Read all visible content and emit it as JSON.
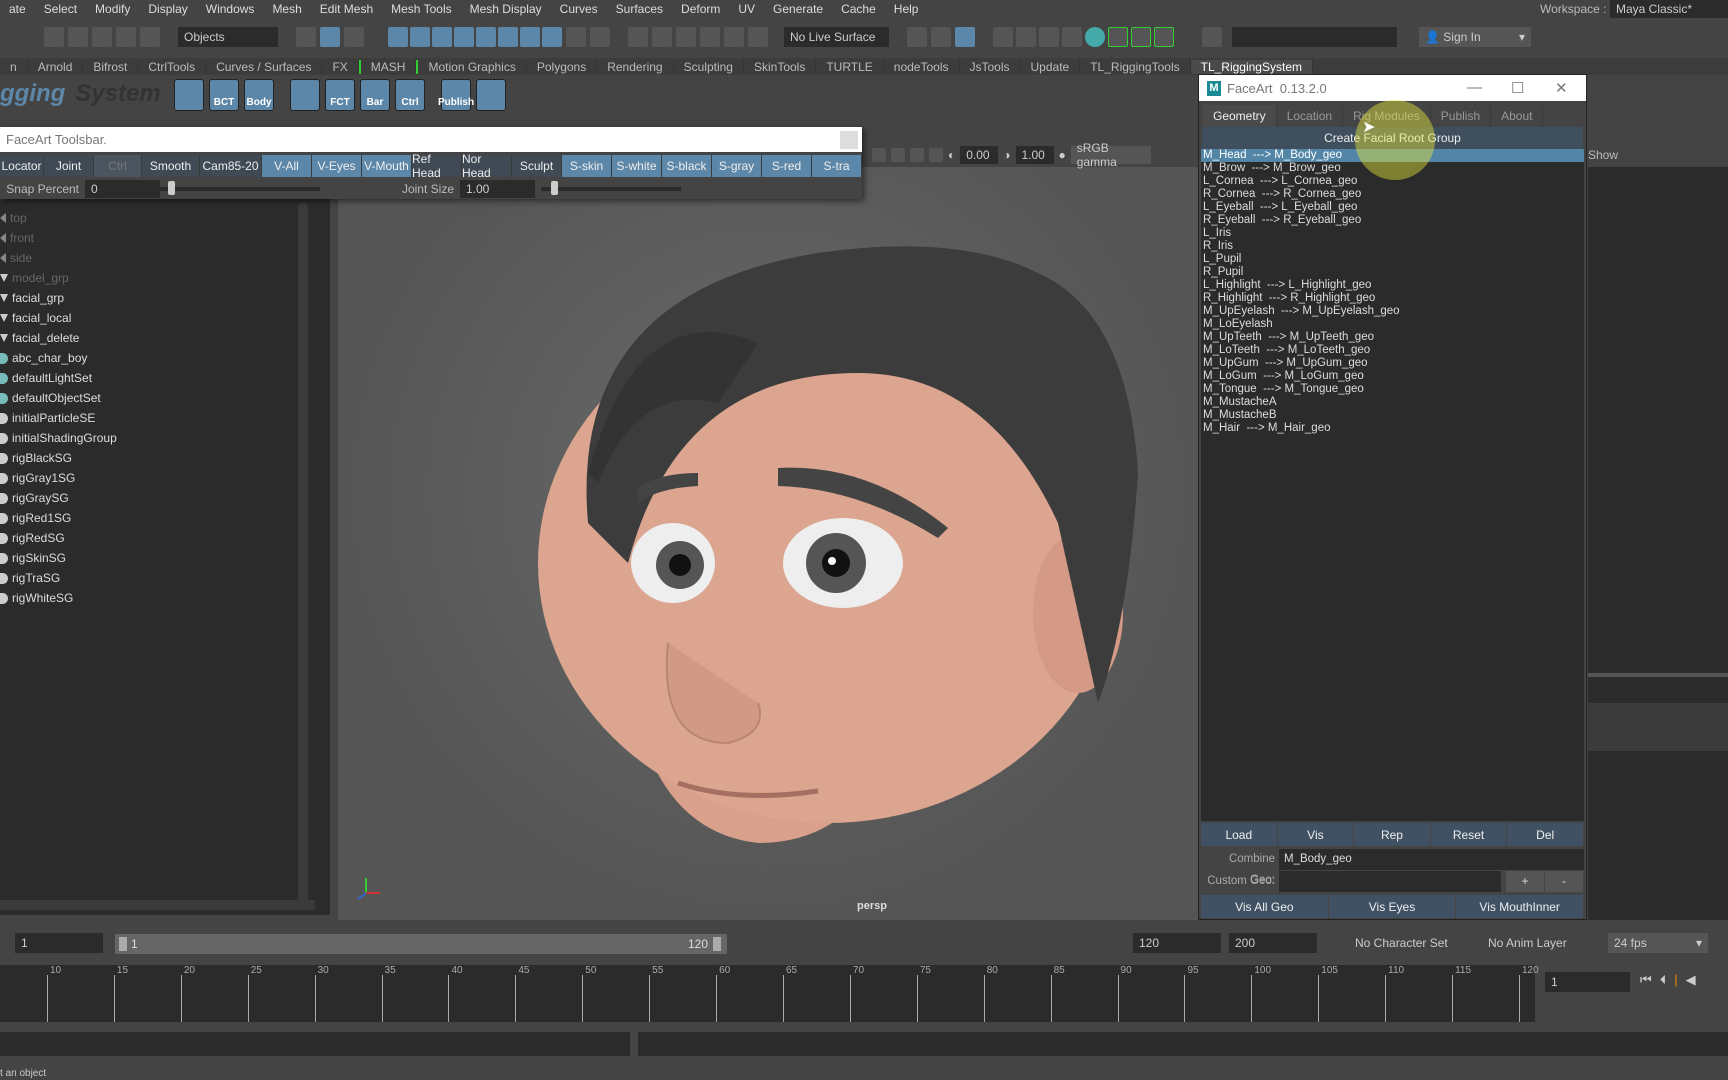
{
  "menubar": {
    "items": [
      "ate",
      "Select",
      "Modify",
      "Display",
      "Windows",
      "Mesh",
      "Edit Mesh",
      "Mesh Tools",
      "Mesh Display",
      "Curves",
      "Surfaces",
      "Deform",
      "UV",
      "Generate",
      "Cache",
      "Help"
    ],
    "workspace_label": "Workspace :",
    "workspace_value": "Maya Classic*"
  },
  "toolbar": {
    "selection_mode": "Objects",
    "live_surface": "No Live Surface",
    "sign_in": "Sign In"
  },
  "shelf": {
    "tabs": [
      "n",
      "Arnold",
      "Bifrost",
      "CtrlTools",
      "Curves / Surfaces",
      "FX",
      "MASH",
      "Motion Graphics",
      "Polygons",
      "Rendering",
      "Sculpting",
      "SkinTools",
      "TURTLE",
      "nodeTools",
      "JsTools",
      "Update",
      "TL_RiggingTools",
      "TL_RiggingSystem"
    ],
    "active_tab": "TL_RiggingSystem",
    "logo": "Rigging System",
    "buttons": [
      "",
      "BCT",
      "Body",
      "",
      "FCT",
      "Bar",
      "Ctrl",
      "Publish",
      ""
    ]
  },
  "toolsbar": {
    "title": "FaceArt Toolsbar.",
    "buttons": [
      {
        "label": "Locator",
        "style": "dark"
      },
      {
        "label": "Joint",
        "style": "dark"
      },
      {
        "label": "Ctrl",
        "style": "disabled"
      },
      {
        "label": "Smooth",
        "style": "dark"
      },
      {
        "label": "Cam85-20",
        "style": "dark"
      },
      {
        "label": "V-All",
        "style": "blue"
      },
      {
        "label": "V-Eyes",
        "style": "blue"
      },
      {
        "label": "V-Mouth",
        "style": "blue"
      },
      {
        "label": "Ref Head",
        "style": "dark"
      },
      {
        "label": "Nor Head",
        "style": "dark"
      },
      {
        "label": "Sculpt",
        "style": "dark"
      },
      {
        "label": "S-skin",
        "style": "blue"
      },
      {
        "label": "S-white",
        "style": "blue"
      },
      {
        "label": "S-black",
        "style": "blue"
      },
      {
        "label": "S-gray",
        "style": "blue"
      },
      {
        "label": "S-red",
        "style": "blue"
      },
      {
        "label": "S-tra",
        "style": "blue"
      }
    ],
    "snap_label": "Snap Percent",
    "snap_value": "0",
    "joint_label": "Joint Size",
    "joint_value": "1.00"
  },
  "outliner": {
    "items": [
      {
        "label": "top",
        "icon": "camera",
        "dim": true
      },
      {
        "label": "front",
        "icon": "camera",
        "dim": true
      },
      {
        "label": "side",
        "icon": "camera",
        "dim": true
      },
      {
        "label": "model_grp",
        "icon": "group",
        "dim": true
      },
      {
        "label": "facial_grp",
        "icon": "group"
      },
      {
        "label": "facial_local",
        "icon": "group"
      },
      {
        "label": "facial_delete",
        "icon": "group"
      },
      {
        "label": "abc_char_boy",
        "icon": "set"
      },
      {
        "label": "defaultLightSet",
        "icon": "set"
      },
      {
        "label": "defaultObjectSet",
        "icon": "set"
      },
      {
        "label": "initialParticleSE",
        "icon": "shading"
      },
      {
        "label": "initialShadingGroup",
        "icon": "shading"
      },
      {
        "label": "rigBlackSG",
        "icon": "shading"
      },
      {
        "label": "rigGray1SG",
        "icon": "shading"
      },
      {
        "label": "rigGraySG",
        "icon": "shading"
      },
      {
        "label": "rigRed1SG",
        "icon": "shading"
      },
      {
        "label": "rigRedSG",
        "icon": "shading"
      },
      {
        "label": "rigSkinSG",
        "icon": "shading"
      },
      {
        "label": "rigTraSG",
        "icon": "shading"
      },
      {
        "label": "rigWhiteSG",
        "icon": "shading"
      }
    ]
  },
  "viewport": {
    "camera": "persp",
    "exposure": "0.00",
    "gamma": "1.00",
    "color_space": "sRGB gamma"
  },
  "faceart": {
    "title": "FaceArt",
    "version": "0.13.2.0",
    "tabs": [
      "Geometry",
      "Location",
      "Rig Modules",
      "Publish",
      "About"
    ],
    "active_tab": "Geometry",
    "create_button": "Create Facial Root Group",
    "geo_list": [
      "M_Head  ---> M_Body_geo",
      "M_Brow  ---> M_Brow_geo",
      "L_Cornea  ---> L_Cornea_geo",
      "R_Cornea  ---> R_Cornea_geo",
      "L_Eyeball  ---> L_Eyeball_geo",
      "R_Eyeball  ---> R_Eyeball_geo",
      "L_Iris",
      "R_Iris",
      "L_Pupil",
      "R_Pupil",
      "L_Highlight  ---> L_Highlight_geo",
      "R_Highlight  ---> R_Highlight_geo",
      "M_UpEyelash  ---> M_UpEyelash_geo",
      "M_LoEyelash",
      "M_UpTeeth  ---> M_UpTeeth_geo",
      "M_LoTeeth  ---> M_LoTeeth_geo",
      "M_UpGum  ---> M_UpGum_geo",
      "M_LoGum  ---> M_LoGum_geo",
      "M_Tongue  ---> M_Tongue_geo",
      "M_MustacheA",
      "M_MustacheB",
      "M_Hair  ---> M_Hair_geo"
    ],
    "selected_index": 0,
    "action_buttons": [
      "Load",
      "Vis",
      "Rep",
      "Reset",
      "Del"
    ],
    "combine_label": "Combine Geo:",
    "combine_value": "M_Body_geo",
    "custom_label": "Custom Geo:",
    "custom_value": "",
    "plus": "+",
    "minus": "-",
    "vis_buttons": [
      "Vis All Geo",
      "Vis Eyes",
      "Vis MouthInner"
    ]
  },
  "channelbox": {
    "show_label": "Show"
  },
  "timerange": {
    "start": "1",
    "range_start": "1",
    "range_end": "120",
    "end": "120",
    "anim_end": "200",
    "character_set": "No Character Set",
    "anim_layer": "No Anim Layer",
    "fps": "24 fps"
  },
  "timeline": {
    "ticks": [
      10,
      15,
      20,
      25,
      30,
      35,
      40,
      45,
      50,
      55,
      60,
      65,
      70,
      75,
      80,
      85,
      90,
      95,
      100,
      105,
      110,
      115,
      120
    ],
    "current_frame": "1"
  },
  "status": {
    "message": "t an object"
  },
  "colors": {
    "accent": "#5d87a8",
    "selection": "#5285a6",
    "panel": "#444444",
    "field": "#2b2b2b"
  }
}
